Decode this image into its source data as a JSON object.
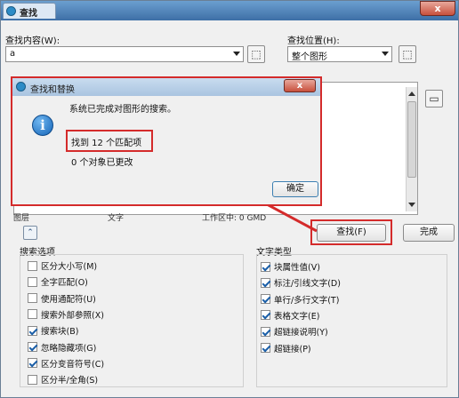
{
  "window": {
    "title": "查找",
    "close_label": "x"
  },
  "find": {
    "content_label": "查找内容(W):",
    "content_value": "a",
    "location_label": "查找位置(H):",
    "location_value": "整个图形"
  },
  "list": {
    "cutoff_left": "图层",
    "cutoff_mid": "文字",
    "cutoff_right": "工作区中: 0 GMD"
  },
  "buttons": {
    "find": "查找(F)",
    "done": "完成"
  },
  "search_options": {
    "title": "搜索选项",
    "items": [
      {
        "label": "区分大小写(M)",
        "checked": false
      },
      {
        "label": "全字匹配(O)",
        "checked": false
      },
      {
        "label": "使用通配符(U)",
        "checked": false
      },
      {
        "label": "搜索外部参照(X)",
        "checked": false
      },
      {
        "label": "搜索块(B)",
        "checked": true
      },
      {
        "label": "忽略隐藏项(G)",
        "checked": true
      },
      {
        "label": "区分变音符号(C)",
        "checked": true
      },
      {
        "label": "区分半/全角(S)",
        "checked": false
      }
    ]
  },
  "text_types": {
    "title": "文字类型",
    "items": [
      {
        "label": "块属性值(V)",
        "checked": true
      },
      {
        "label": "标注/引线文字(D)",
        "checked": true
      },
      {
        "label": "单行/多行文字(T)",
        "checked": true
      },
      {
        "label": "表格文字(E)",
        "checked": true
      },
      {
        "label": "超链接说明(Y)",
        "checked": true
      },
      {
        "label": "超链接(P)",
        "checked": true
      }
    ]
  },
  "dialog": {
    "title": "查找和替换",
    "close_label": "x",
    "message": "系统已完成对图形的搜索。",
    "found": "找到 12 个匹配项",
    "changed": "0 个对象已更改",
    "ok": "确定"
  },
  "colors": {
    "highlight": "#d42b2b",
    "titlebar": "#3e6fa6"
  }
}
